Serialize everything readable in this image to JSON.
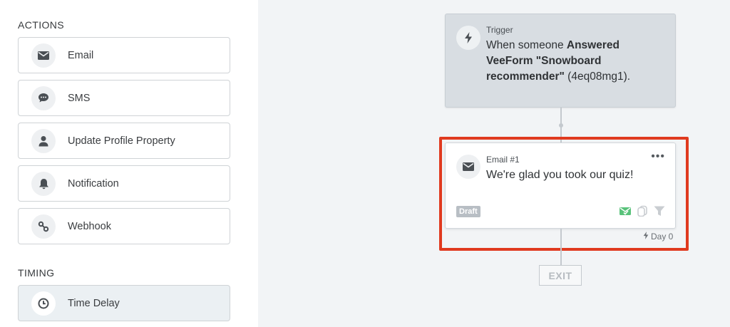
{
  "sidebar": {
    "actions_title": "ACTIONS",
    "timing_title": "TIMING",
    "actions": [
      {
        "label": "Email",
        "icon": "envelope-icon"
      },
      {
        "label": "SMS",
        "icon": "chat-bubble-icon"
      },
      {
        "label": "Update Profile Property",
        "icon": "person-icon"
      },
      {
        "label": "Notification",
        "icon": "bell-icon"
      },
      {
        "label": "Webhook",
        "icon": "webhook-icon"
      }
    ],
    "timing": [
      {
        "label": "Time Delay",
        "icon": "clock-icon"
      }
    ]
  },
  "flow": {
    "trigger": {
      "kicker": "Trigger",
      "text_prefix": "When someone ",
      "text_bold": "Answered VeeForm \"Snowboard recommender\"",
      "text_suffix": " (4eq08mg1)."
    },
    "email": {
      "kicker": "Email #1",
      "subject": "We're glad you took our quiz!",
      "status": "Draft",
      "more": "•••",
      "day": "Day 0"
    },
    "exit_label": "EXIT"
  },
  "colors": {
    "highlight": "#e03a1f",
    "canvas_bg": "#f2f4f6",
    "trigger_bg": "#d8dde2",
    "check_green": "#59c27a"
  }
}
